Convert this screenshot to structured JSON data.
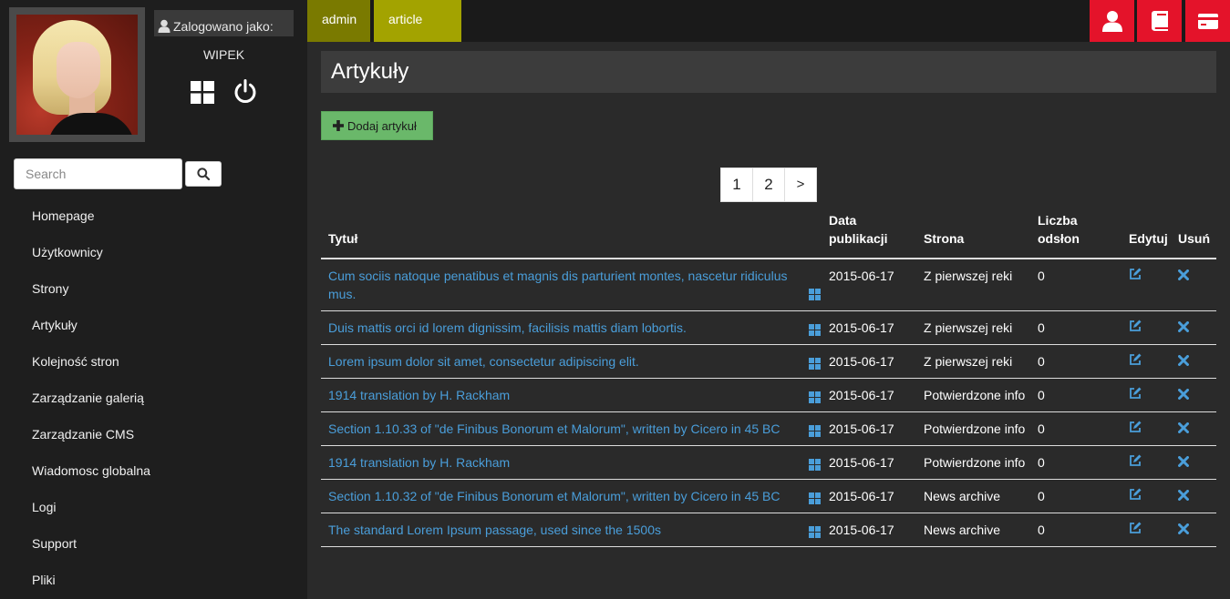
{
  "sidebar": {
    "logged_as_label": "Zalogowano jako:",
    "username": "WIPEK",
    "search": {
      "placeholder": "Search"
    },
    "menu": [
      {
        "label": "Homepage"
      },
      {
        "label": "Użytkownicy"
      },
      {
        "label": "Strony"
      },
      {
        "label": "Artykuły"
      },
      {
        "label": "Kolejność stron"
      },
      {
        "label": "Zarządzanie galerią"
      },
      {
        "label": "Zarządzanie CMS"
      },
      {
        "label": "Wiadomosc globalna"
      },
      {
        "label": "Logi"
      },
      {
        "label": "Support"
      },
      {
        "label": "Pliki"
      }
    ]
  },
  "topbar": {
    "breadcrumbs": [
      {
        "label": "admin"
      },
      {
        "label": "article"
      }
    ],
    "icons": [
      "user-icon",
      "book-icon",
      "credit-card-icon"
    ],
    "accent": "#e4132a"
  },
  "main": {
    "title": "Artykuły",
    "add_button_label": "Dodaj artykuł",
    "pagination": {
      "pages": [
        "1",
        "2"
      ],
      "next": ">"
    },
    "table": {
      "headers": {
        "title": "Tytuł",
        "date": "Data publikacji",
        "site": "Strona",
        "views": "Liczba odsłon",
        "edit": "Edytuj",
        "delete": "Usuń"
      },
      "rows": [
        {
          "title": "Cum sociis natoque penatibus et magnis dis parturient montes, nascetur ridiculus mus.",
          "date": "2015-06-17",
          "site": "Z pierwszej reki",
          "views": "0"
        },
        {
          "title": "Duis mattis orci id lorem dignissim, facilisis mattis diam lobortis.",
          "date": "2015-06-17",
          "site": "Z pierwszej reki",
          "views": "0"
        },
        {
          "title": "Lorem ipsum dolor sit amet, consectetur adipiscing elit.",
          "date": "2015-06-17",
          "site": "Z pierwszej reki",
          "views": "0"
        },
        {
          "title": "1914 translation by H. Rackham",
          "date": "2015-06-17",
          "site": "Potwierdzone info",
          "views": "0"
        },
        {
          "title": "Section 1.10.33 of \"de Finibus Bonorum et Malorum\", written by Cicero in 45 BC",
          "date": "2015-06-17",
          "site": "Potwierdzone info",
          "views": "0"
        },
        {
          "title": "1914 translation by H. Rackham",
          "date": "2015-06-17",
          "site": "Potwierdzone info",
          "views": "0"
        },
        {
          "title": "Section 1.10.32 of \"de Finibus Bonorum et Malorum\", written by Cicero in 45 BC",
          "date": "2015-06-17",
          "site": "News archive",
          "views": "0"
        },
        {
          "title": "The standard Lorem Ipsum passage, used since the 1500s",
          "date": "2015-06-17",
          "site": "News archive",
          "views": "0"
        }
      ]
    }
  }
}
